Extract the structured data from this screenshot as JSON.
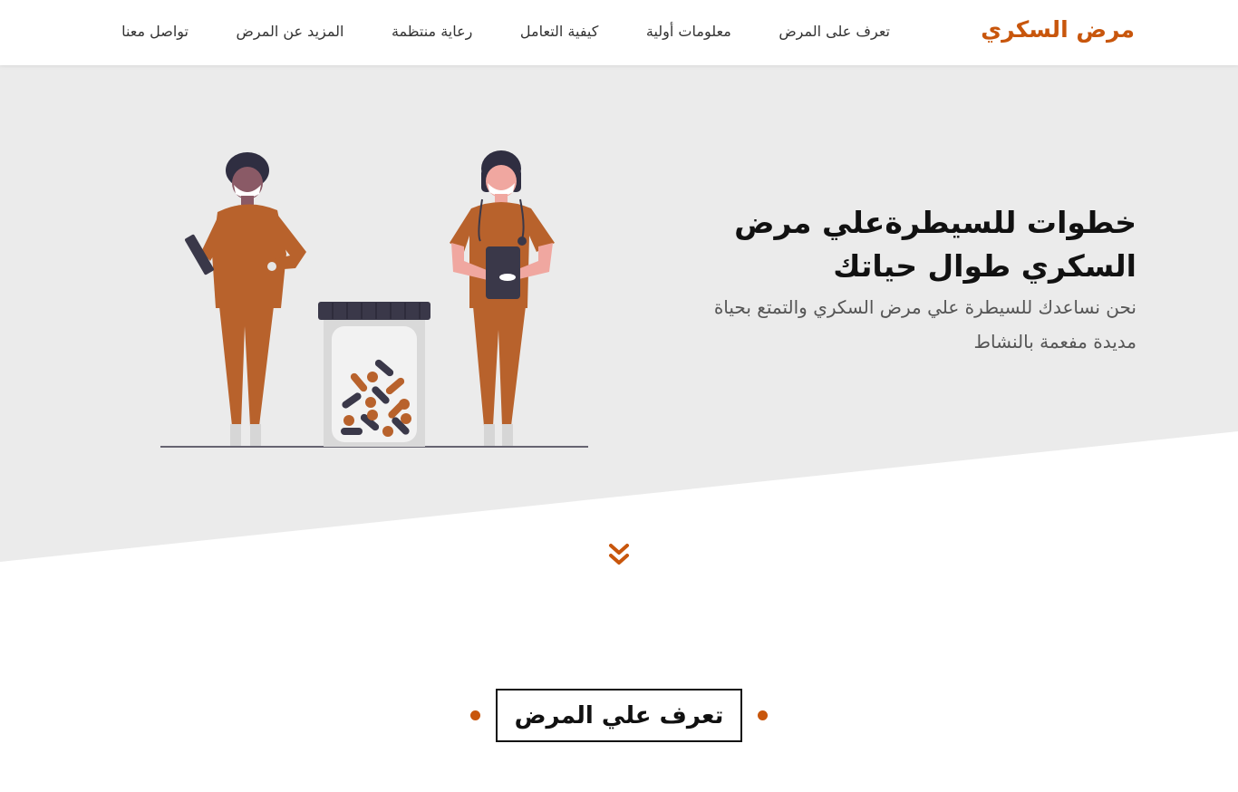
{
  "header": {
    "brand": "مرض السكري",
    "nav": [
      "تعرف على المرض",
      "معلومات أولية",
      "كيفية التعامل",
      "رعاية منتظمة",
      "المزيد عن المرض",
      "تواصل معنا"
    ]
  },
  "hero": {
    "title": "خطوات للسيطرةعلي مرض السكري طوال حياتك",
    "subtitle": "نحن نساعدك للسيطرة علي مرض السكري والتمتع بحياة مديدة مفعمة بالنشاط",
    "illustration": "doctors-and-pill-jar-illustration",
    "scroll_icon": "double-chevron-down-icon"
  },
  "section": {
    "title": "تعرف علي المرض"
  },
  "colors": {
    "accent": "#c8560c",
    "hero_bg": "#ebebeb",
    "scrubs": "#b8622c",
    "dark": "#3a3849",
    "skin": "#f0a7a0",
    "jar": "#d9d9d9"
  }
}
